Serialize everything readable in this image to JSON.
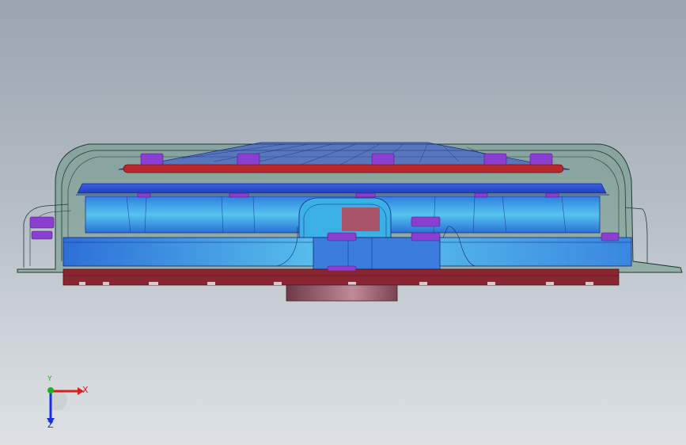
{
  "scene": {
    "background_top": "#9aa5b0",
    "background_bottom": "#dde1e4",
    "colors": {
      "housing": "#5b8f7a",
      "cover_blue": "#2f56d8",
      "rotor_blue": "#3aa3e0",
      "rim_red": "#b7272c",
      "hub": "#8a4d5c",
      "fastener": "#8b3fd0",
      "base_red": "#7e1f2a"
    }
  },
  "triad": {
    "x_label": "X",
    "y_label": "Y",
    "z_label": "Z",
    "x_color": "#e01b1b",
    "y_color": "#1bb51b",
    "z_color": "#1b2fe0"
  }
}
